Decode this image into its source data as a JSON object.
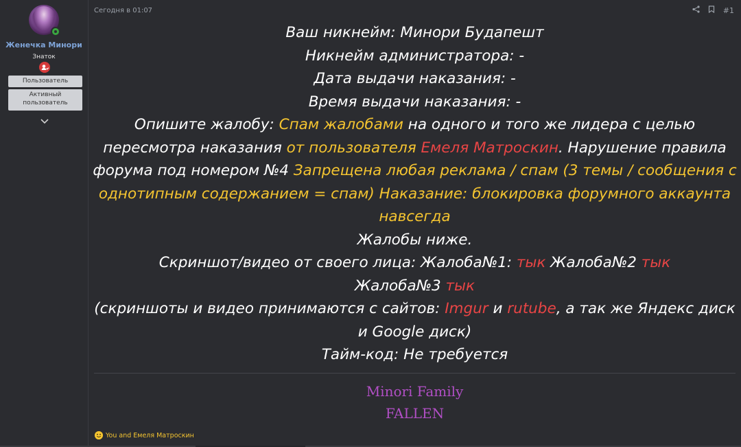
{
  "user": {
    "name": "Женечка Минори",
    "title": "Знаток",
    "roles": [
      "Пользователь",
      "Активный пользователь"
    ]
  },
  "post": {
    "time": "Сегодня в 01:07",
    "number": "#1",
    "lines": [
      "Ваш никнейм: Минори Будапешт",
      "Никнейм администратора: -",
      "Дата выдачи наказания: -",
      "Время выдачи наказания: -"
    ],
    "complaint": {
      "label": "Опишите жалобу: ",
      "y1": "Спам жалобами",
      "t1": " на одного и того же лидера с целью пересмотра наказания ",
      "y2": "от пользователя",
      "r1": " Емеля Матроскин",
      "t2": ". Нарушение правила форума под номером №4 ",
      "y3": "Запрещена любая реклама / спам (3 темы / сообщения с однотипным содержанием = спам) Наказание: блокировка форумного аккаунта навсегда"
    },
    "below": "Жалобы ниже.",
    "evidence": {
      "label": "Скриншот/видео от своего лица: ",
      "c1": "Жалоба№1: ",
      "l1": "тык",
      "c2": " Жалоба№2 ",
      "l2": "тык",
      "c3": "Жалоба№3 ",
      "l3": "тык"
    },
    "note": {
      "t1": "(скриншоты и видео принимаются с сайтов: ",
      "l1": "Imgur",
      "t2": " и ",
      "l2": "rutube",
      "t3": ", а так же Яндекс диск и Google диск)"
    },
    "timecode": "Тайм-код: Не требуется"
  },
  "signature": [
    "Minori Family",
    "FALLEN"
  ],
  "reactions": "You and Емеля Матроскин",
  "icons": {
    "share": "share-icon",
    "bookmark": "bookmark-icon",
    "expand": "chevron-down-icon",
    "badge": "user-badge-icon",
    "reaction": "reaction-emoji-icon"
  },
  "colors": {
    "background": "#2b2c30",
    "highlight_yellow": "#f4c430",
    "highlight_red": "#e84545",
    "signature": "#b14fc5",
    "username": "#7ea3d6"
  }
}
